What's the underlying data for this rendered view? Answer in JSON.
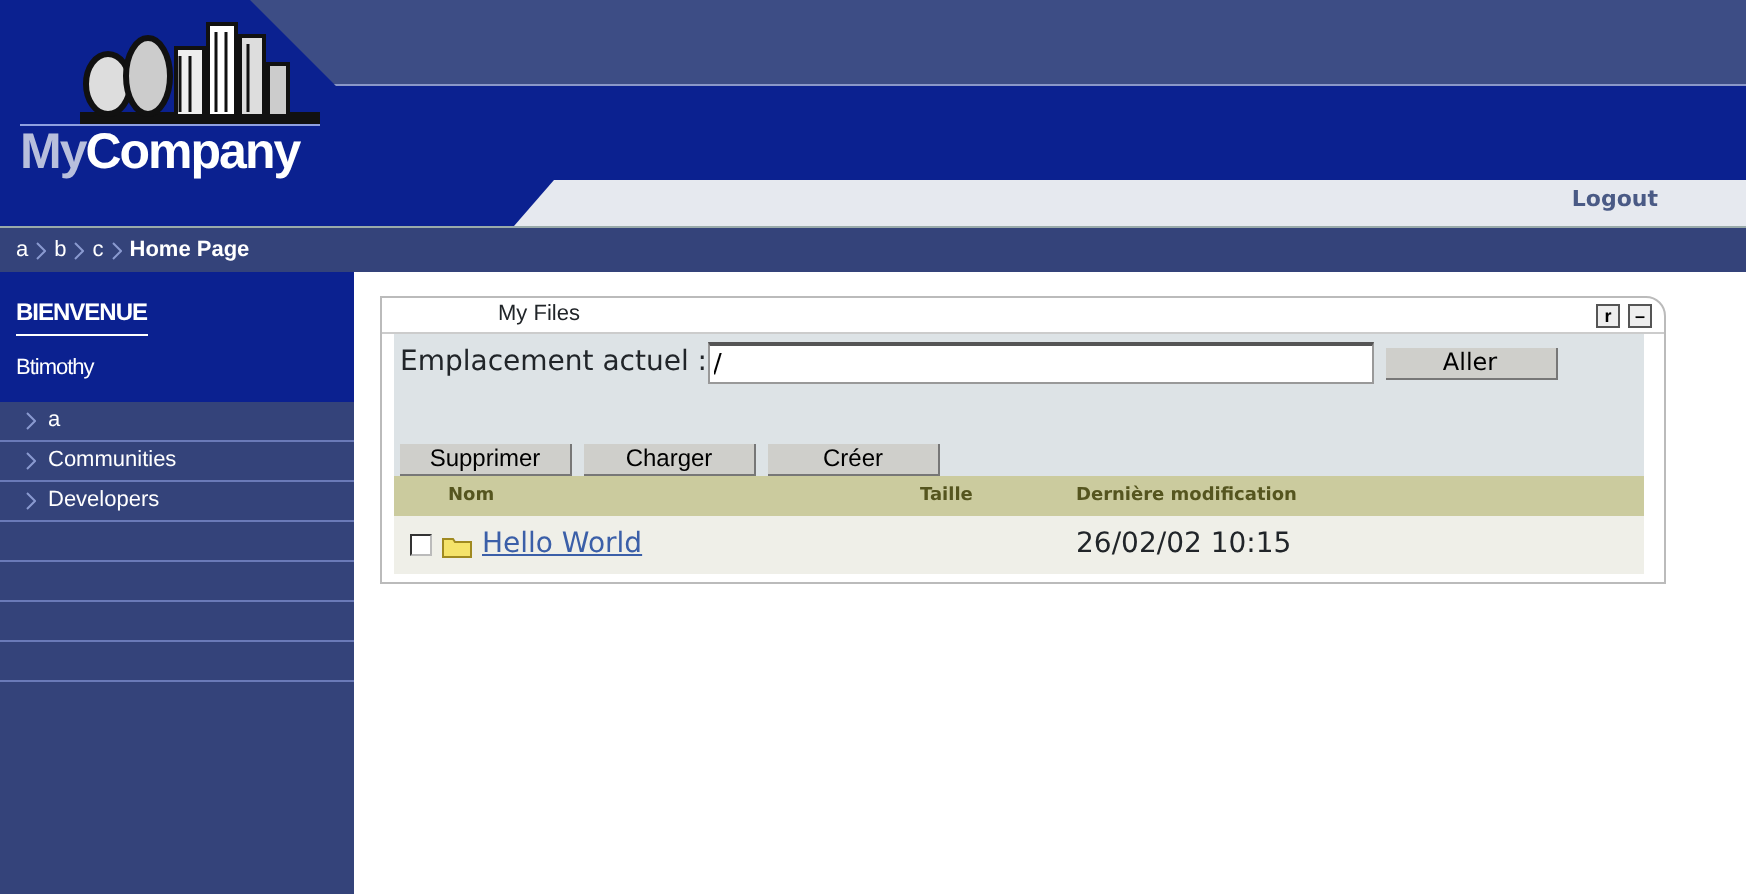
{
  "logo": {
    "parts": [
      "My",
      "Company"
    ]
  },
  "header": {
    "logout": "Logout"
  },
  "breadcrumb": {
    "items": [
      "a",
      "b",
      "c"
    ],
    "current": "Home Page"
  },
  "sidebar": {
    "title": "BIENVENUE",
    "user": "Btimothy",
    "items": [
      {
        "label": "a"
      },
      {
        "label": "Communities"
      },
      {
        "label": "Developers"
      }
    ]
  },
  "portlet": {
    "title": "My Files",
    "controls": [
      "r",
      "–"
    ],
    "location_label": "Emplacement actuel :",
    "location_value": "/",
    "go_button": "Aller",
    "actions": [
      "Supprimer",
      "Charger",
      "Créer"
    ],
    "columns": [
      "Nom",
      "Taille",
      "Dernière modification"
    ],
    "rows": [
      {
        "checked": false,
        "name": "Hello World",
        "size": "",
        "modified": "26/02/02 10:15"
      }
    ]
  }
}
